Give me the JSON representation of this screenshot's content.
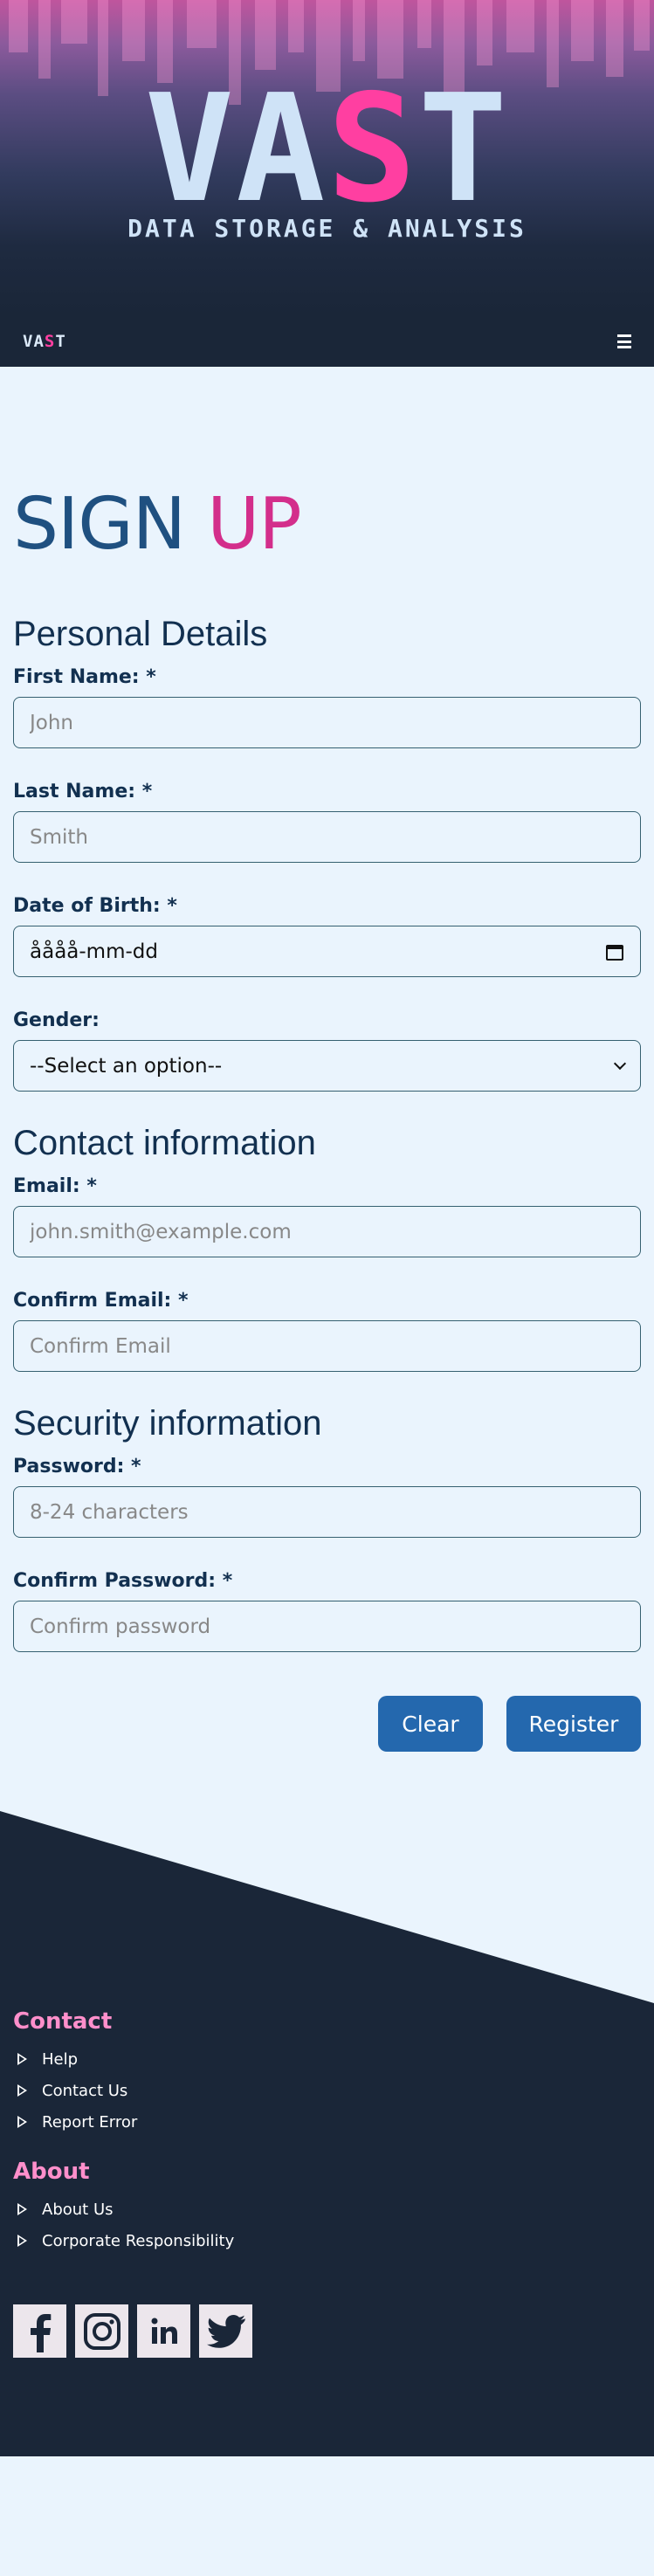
{
  "hero": {
    "logo_part1": "VA",
    "logo_accent": "S",
    "logo_part2": "T",
    "tagline": "DATA STORAGE & ANALYSIS"
  },
  "navbar": {
    "logo_part1": "VA",
    "logo_accent": "S",
    "logo_part2": "T",
    "menu_icon": "hamburger-menu-icon"
  },
  "page": {
    "title_part1": "SIGN",
    "title_part2": "UP"
  },
  "personal": {
    "heading": "Personal Details",
    "first_name": {
      "label": "First Name: *",
      "placeholder": "John",
      "value": ""
    },
    "last_name": {
      "label": "Last Name: *",
      "placeholder": "Smith",
      "value": ""
    },
    "dob": {
      "label": "Date of Birth: *",
      "value": "åååå-mm-dd",
      "icon": "calendar-icon"
    },
    "gender": {
      "label": "Gender:",
      "selected": "--Select an option--",
      "icon": "chevron-down-icon"
    }
  },
  "contact": {
    "heading": "Contact information",
    "email": {
      "label": "Email: *",
      "placeholder": "john.smith@example.com",
      "value": ""
    },
    "confirm_email": {
      "label": "Confirm Email: *",
      "placeholder": "Confirm Email",
      "value": ""
    }
  },
  "security": {
    "heading": "Security information",
    "password": {
      "label": "Password: *",
      "placeholder": "8-24 characters",
      "value": ""
    },
    "confirm_password": {
      "label": "Confirm Password: *",
      "placeholder": "Confirm password",
      "value": ""
    }
  },
  "actions": {
    "clear_label": "Clear",
    "register_label": "Register"
  },
  "footer": {
    "contact_heading": "Contact",
    "contact_links": [
      "Help",
      "Contact Us",
      "Report Error"
    ],
    "about_heading": "About",
    "about_links": [
      "About Us",
      "Corporate Responsibility"
    ],
    "socials": [
      "facebook-icon",
      "instagram-icon",
      "linkedin-icon",
      "twitter-icon"
    ]
  },
  "colors": {
    "accent_pink": "#ff3fa1",
    "title_blue": "#1f5080",
    "title_pink": "#d32e8b",
    "button_blue": "#2468ae",
    "footer_bg": "#1a2638",
    "footer_heading": "#ff8fcb",
    "page_bg": "#eaf4fd"
  }
}
